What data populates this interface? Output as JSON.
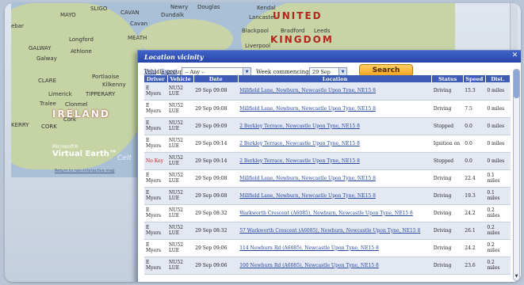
{
  "map": {
    "places": [
      "SLIGO",
      "CAVAN",
      "MAYO",
      "Cavan",
      "Dundalk",
      "Newry",
      "Douglas",
      "Kendal",
      "Lancaster",
      "Blackpool",
      "Bradford",
      "Leeds",
      "Liverpool",
      "MEATH",
      "Longford",
      "GALWAY",
      "Galway",
      "Athlone",
      "CLARE",
      "Portlaoise",
      "Kilkenny",
      "Limerick",
      "TIPPERARY",
      "Tralee",
      "Clonmel",
      "KERRY",
      "CORK",
      "Cork",
      "ebar"
    ],
    "countries": {
      "uk_line1": "UNITED",
      "uk_line2": "KINGDOM",
      "ireland": "IRELAND"
    },
    "brand_small": "Microsoft®",
    "brand_big": "Virtual Earth™",
    "watermark": "Celt",
    "return_link": "Return to non-interactive map"
  },
  "dialog": {
    "title": "Location vicinity",
    "vehicle_group_label": "Vehicle group:",
    "vehicle_group_value": "-- Any --",
    "week_label": "Week commencing",
    "week_value": "29 Sep",
    "search_label": "Search",
    "print_link": "Print",
    "export_link": "Export",
    "link_separator": "|",
    "columns": [
      "Driver",
      "Vehicle",
      "Date",
      "Location",
      "Status",
      "Speed",
      "Dist."
    ],
    "rows": [
      {
        "driver": "E Myers",
        "vehicle": "NU52 LUE",
        "date": "29 Sep 09:08",
        "location": "Millfield Lane, Newburn, Newcastle Upon Tyne, NE15 8",
        "status": "Driving",
        "speed": "15.3",
        "dist": "0 miles"
      },
      {
        "driver": "E Myers",
        "vehicle": "NU52 LUE",
        "date": "29 Sep 09:08",
        "location": "Millfield Lane, Newburn, Newcastle Upon Tyne, NE15 8",
        "status": "Driving",
        "speed": "7.5",
        "dist": "0 miles"
      },
      {
        "driver": "E Myers",
        "vehicle": "NU52 LUE",
        "date": "29 Sep 09:09",
        "location": "2 Berkley Terrace, Newcastle Upon Tyne, NE15 8",
        "status": "Stopped",
        "speed": "0.0",
        "dist": "0 miles"
      },
      {
        "driver": "E Myers",
        "vehicle": "NU52 LUE",
        "date": "29 Sep 09:14",
        "location": "2 Berkley Terrace, Newcastle Upon Tyne, NE15 8",
        "status": "Ignition on",
        "speed": "0.0",
        "dist": "0 miles"
      },
      {
        "driver": "No Key",
        "vehicle": "NU52 LUE",
        "date": "29 Sep 09:14",
        "location": "2 Berkley Terrace, Newcastle Upon Tyne, NE15 8",
        "status": "Stopped",
        "speed": "0.0",
        "dist": "0 miles"
      },
      {
        "driver": "E Myers",
        "vehicle": "NU52 LUE",
        "date": "29 Sep 09:08",
        "location": "Millfield Lane, Newburn, Newcastle Upon Tyne, NE15 8",
        "status": "Driving",
        "speed": "22.4",
        "dist": "0.1 miles"
      },
      {
        "driver": "E Myers",
        "vehicle": "NU52 LUE",
        "date": "29 Sep 09:08",
        "location": "Millfield Lane, Newburn, Newcastle Upon Tyne, NE15 8",
        "status": "Driving",
        "speed": "19.3",
        "dist": "0.1 miles"
      },
      {
        "driver": "E Myers",
        "vehicle": "NU52 LUE",
        "date": "29 Sep 08:32",
        "location": "Warkworth Crescent (A6085), Newburn, Newcastle Upon Tyne, NE15 8",
        "status": "Driving",
        "speed": "24.2",
        "dist": "0.2 miles"
      },
      {
        "driver": "E Myers",
        "vehicle": "NU52 LUE",
        "date": "29 Sep 08:32",
        "location": "57 Warkworth Crescent (A6085), Newburn, Newcastle Upon Tyne, NE15 8",
        "status": "Driving",
        "speed": "26.1",
        "dist": "0.2 miles"
      },
      {
        "driver": "E Myers",
        "vehicle": "NU52 LUE",
        "date": "29 Sep 09:06",
        "location": "114 Newburn Rd (A6085), Newcastle Upon Tyne, NE15 8",
        "status": "Driving",
        "speed": "24.2",
        "dist": "0.2 miles"
      },
      {
        "driver": "E Myers",
        "vehicle": "NU52 LUE",
        "date": "29 Sep 09:06",
        "location": "100 Newburn Rd (A6085), Newcastle Upon Tyne, NE15 8",
        "status": "Driving",
        "speed": "23.6",
        "dist": "0.2 miles"
      }
    ]
  },
  "colors": {
    "titlebar": "#2f50b8",
    "header": "#3c5cb6",
    "search_button": "#f5a21f",
    "country_label": "#b3261e",
    "no_key": "#cc2222"
  }
}
